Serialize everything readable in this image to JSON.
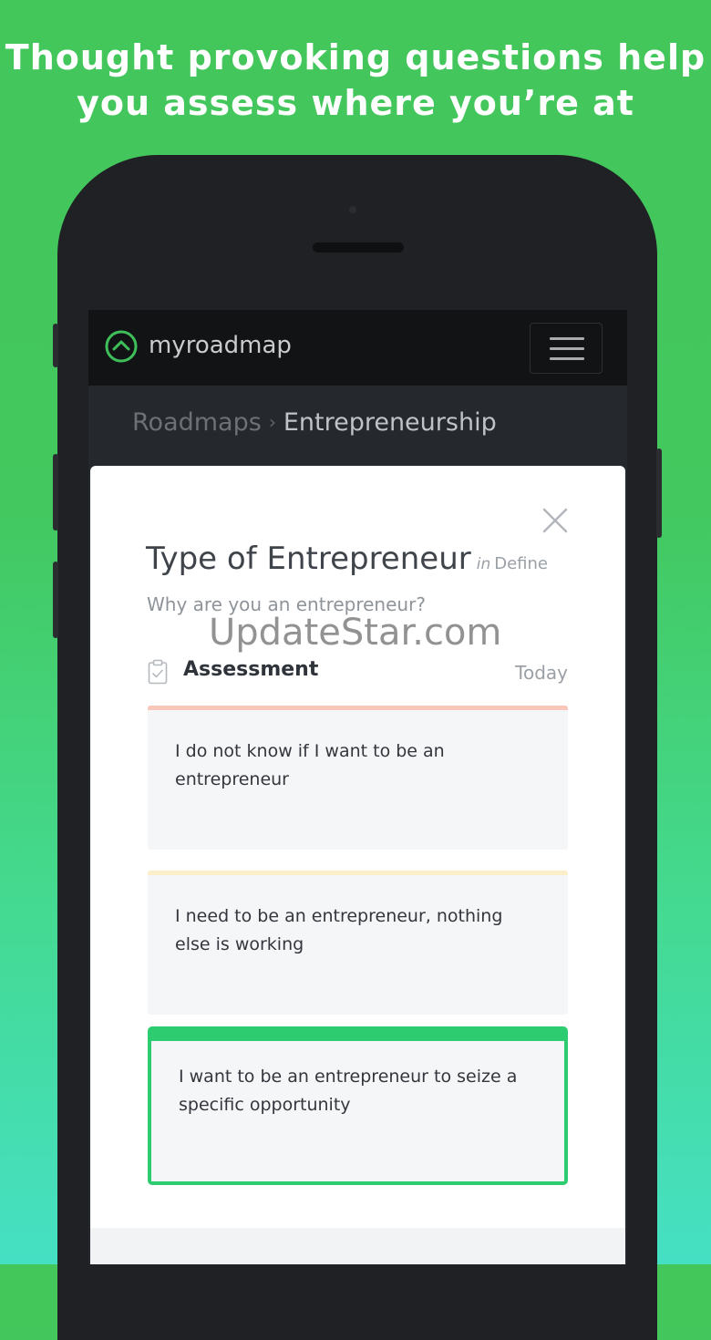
{
  "headline": {
    "line1": "Thought provoking questions help",
    "line2": "you assess where you’re at"
  },
  "app": {
    "logo_text": "myroadmap",
    "logo_icon": "chevron-up-circle-icon",
    "menu_icon": "hamburger-menu-icon"
  },
  "breadcrumb": {
    "parent": "Roadmaps",
    "separator": "›",
    "current": "Entrepreneurship"
  },
  "modal": {
    "close_icon": "close-icon",
    "title": "Type of Entrepreneur",
    "in_label": "in",
    "section": "Define",
    "subtitle": "Why are you an entrepreneur?",
    "watermark": "UpdateStar.com",
    "assessment": {
      "icon": "clipboard-check-icon",
      "title": "Assessment",
      "date": "Today"
    },
    "options": [
      {
        "text": "I do not know if I want to be an entrepreneur",
        "accent": "#f8c7b9",
        "selected": false
      },
      {
        "text": "I need to be an entrepreneur, nothing else is working",
        "accent": "#fbefc9",
        "selected": false
      },
      {
        "text": "I want to be an entrepreneur to seize a specific opportunity",
        "accent": "#2ecc71",
        "selected": true
      }
    ]
  },
  "colors": {
    "background_top": "#43c65a",
    "background_bottom": "#45e0c4",
    "selected_accent": "#2ecc71",
    "phone_body": "#202124"
  }
}
